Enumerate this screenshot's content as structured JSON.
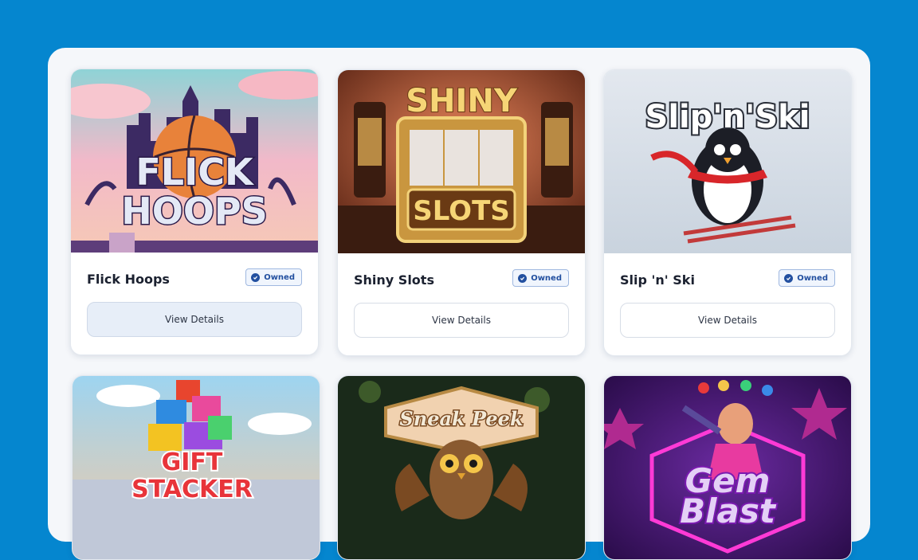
{
  "games": [
    {
      "title": "Flick Hoops",
      "badge": "Owned",
      "button": "View Details",
      "art_text": [
        "FLICK",
        "HOOPS"
      ]
    },
    {
      "title": "Shiny Slots",
      "badge": "Owned",
      "button": "View Details",
      "art_text": [
        "SHINY",
        "SLOTS"
      ]
    },
    {
      "title": "Slip 'n' Ski",
      "badge": "Owned",
      "button": "View Details",
      "art_text": [
        "Slip'n'Ski"
      ]
    },
    {
      "art_text": [
        "GIFT",
        "STACKER"
      ]
    },
    {
      "art_text": [
        "Sneak Peek"
      ]
    },
    {
      "art_text": [
        "Gem",
        "Blast"
      ]
    }
  ],
  "colors": {
    "background": "#0586cf",
    "badge": "#2350a0"
  }
}
